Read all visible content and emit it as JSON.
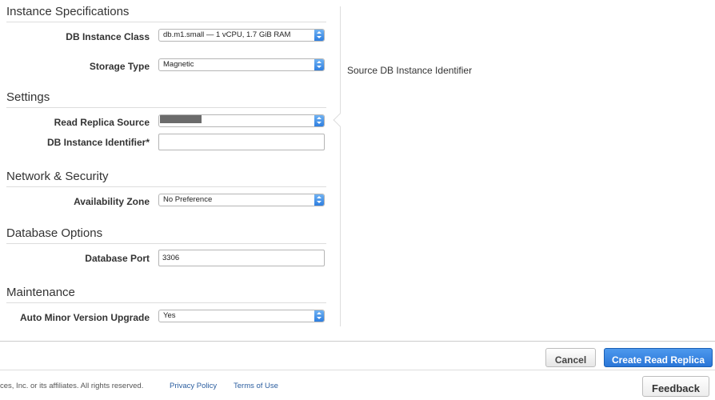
{
  "sections": {
    "instance_specifications": "Instance Specifications",
    "settings": "Settings",
    "network_security": "Network & Security",
    "database_options": "Database Options",
    "maintenance": "Maintenance"
  },
  "fields": {
    "db_instance_class": {
      "label": "DB Instance Class",
      "value": "db.m1.small — 1 vCPU, 1.7 GiB RAM"
    },
    "storage_type": {
      "label": "Storage Type",
      "value": "Magnetic"
    },
    "read_replica_source": {
      "label": "Read Replica Source"
    },
    "db_instance_identifier": {
      "label": "DB Instance Identifier*",
      "value": ""
    },
    "availability_zone": {
      "label": "Availability Zone",
      "value": "No Preference"
    },
    "database_port": {
      "label": "Database Port",
      "value": "3306"
    },
    "auto_minor_version_upgrade": {
      "label": "Auto Minor Version Upgrade",
      "value": "Yes"
    }
  },
  "help": {
    "text": "Source DB Instance Identifier"
  },
  "actions": {
    "cancel": "Cancel",
    "create": "Create Read Replica"
  },
  "footer": {
    "copyright": "ces, Inc. or its affiliates. All rights reserved.",
    "privacy": "Privacy Policy",
    "terms": "Terms of Use",
    "feedback": "Feedback"
  },
  "colors": {
    "accent": "#2a76d8",
    "link": "#2a5d9f",
    "divider": "#dddddd"
  },
  "icons": {
    "select_arrow": "select-arrows-icon"
  }
}
